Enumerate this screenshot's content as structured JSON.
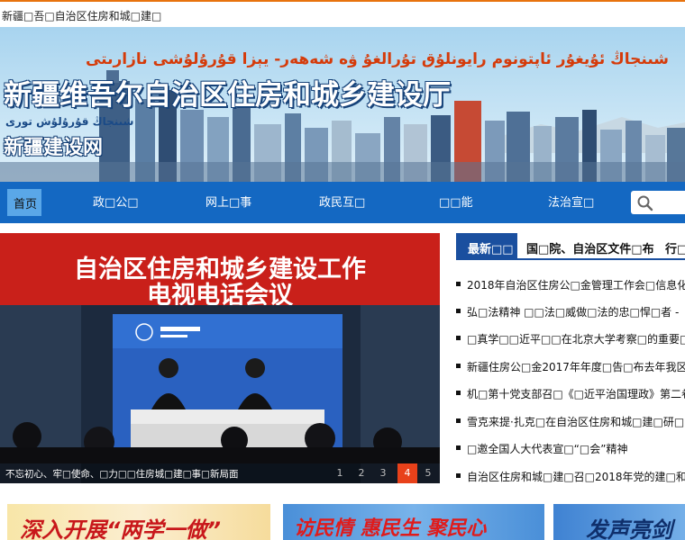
{
  "window": {
    "title": "新疆□吾□自治区住房和城□建□"
  },
  "banner": {
    "uyghur_title": "شىنجاڭ ئۇيغۇر ئاپتونوم رايونلۇق تۇرالغۇ ۋە شەھەر- يېزا قۇرۇلۇشى نازارىتى",
    "chinese_title": "新疆维吾尔自治区住房和城乡建设厅",
    "uyghur_sub": "شىنجاڭ قۇرۇلۇش تورى",
    "chinese_sub": "新疆建设网"
  },
  "nav": {
    "items": [
      {
        "label": "首页"
      },
      {
        "label": "政□公□"
      },
      {
        "label": "网上□事"
      },
      {
        "label": "政民互□"
      },
      {
        "label": "□□能"
      },
      {
        "label": "法治宣□"
      }
    ],
    "search_icon": "search-icon"
  },
  "slideshow": {
    "screen_line1": "自治区住房和城乡建设工作",
    "screen_line2": "电视电话会议",
    "caption": "不忘初心、牢□使命、□力□□住房城□建□事□新局面",
    "pages": [
      "1",
      "2",
      "3",
      "4",
      "5"
    ],
    "current_page": "4"
  },
  "tabs": [
    {
      "label": "最新□□"
    },
    {
      "label": "国□院、自治区文件□布"
    },
    {
      "label": "行□"
    }
  ],
  "news": [
    "2018年自治区住房公□金管理工作会□信息化",
    "弘□法精神 □□法□威做□法的忠□悍□者 -",
    "□真学□□近平□□在北京大学考察□的重要□",
    "新疆住房公□金2017年年度□告□布去年我区共",
    "机□第十党支部召□《□近平治国理政》第二卷",
    "雪克来提·扎克□在自治区住房和城□建□研□",
    "□邀全国人大代表宣□“□会”精神",
    "自治区住房和城□建□召□2018年党的建□和党"
  ],
  "bottom_banners": [
    {
      "text": "深入开展“两学一做”"
    },
    {
      "text": "访民情 惠民生 聚民心"
    },
    {
      "text": "发声亮剑"
    }
  ]
}
